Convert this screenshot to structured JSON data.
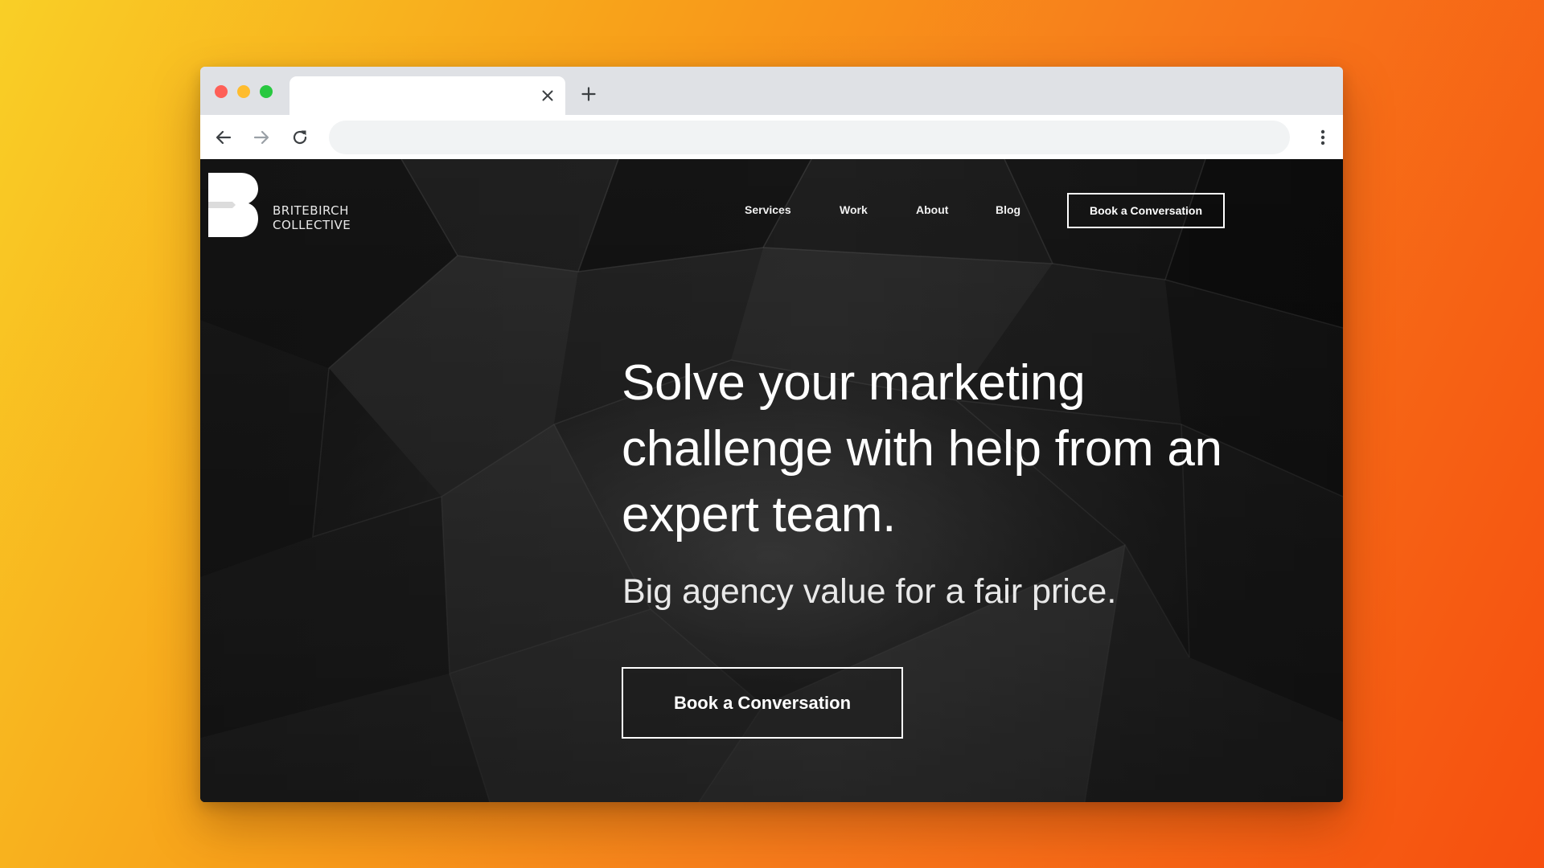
{
  "colors": {
    "background_gradient": [
      "#f9cf26",
      "#f8a21a",
      "#f7791b",
      "#f64f0f"
    ],
    "chrome": "#dfe1e5",
    "traffic_red": "#fe5f57",
    "traffic_yellow": "#febc2e",
    "traffic_green": "#28c840",
    "hero_text": "#ffffff"
  },
  "browser": {
    "tab_title": "",
    "url": "",
    "icons": {
      "close": "close-icon",
      "new_tab": "plus-icon",
      "back": "arrow-left-icon",
      "forward": "arrow-right-icon",
      "reload": "reload-icon",
      "menu": "kebab-menu-icon"
    }
  },
  "site": {
    "logo": {
      "line1": "Britebirch",
      "line2": "Collective"
    },
    "nav": {
      "items": [
        {
          "label": "Services"
        },
        {
          "label": "Work"
        },
        {
          "label": "About"
        },
        {
          "label": "Blog"
        }
      ],
      "cta_label": "Book a Conversation"
    },
    "hero": {
      "title": "Solve your marketing challenge with help from an expert team.",
      "subtitle": "Big agency value for a fair price.",
      "cta_label": "Book a Conversation"
    }
  }
}
